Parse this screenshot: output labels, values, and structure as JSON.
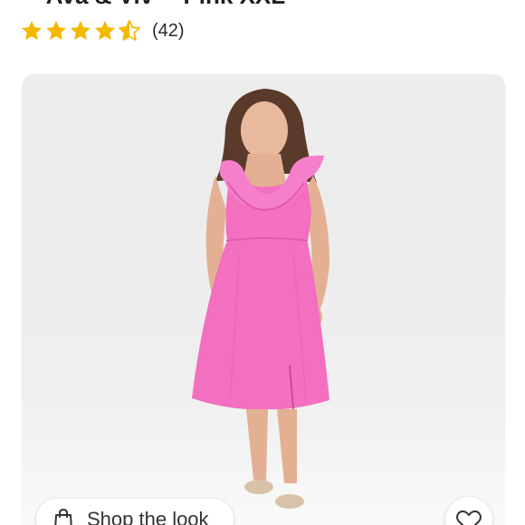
{
  "product": {
    "title_partial": "– Ava & Viv™ Pink XXL",
    "rating": 4.5,
    "rating_count": "(42)"
  },
  "icons": {
    "star": "star-icon",
    "bag": "shopping-bag-icon",
    "heart": "heart-icon"
  },
  "actions": {
    "shop_the_look": "Shop the look"
  },
  "colors": {
    "star": "#f5b800",
    "dress": "#f36fc0",
    "image_bg": "#ececec"
  }
}
